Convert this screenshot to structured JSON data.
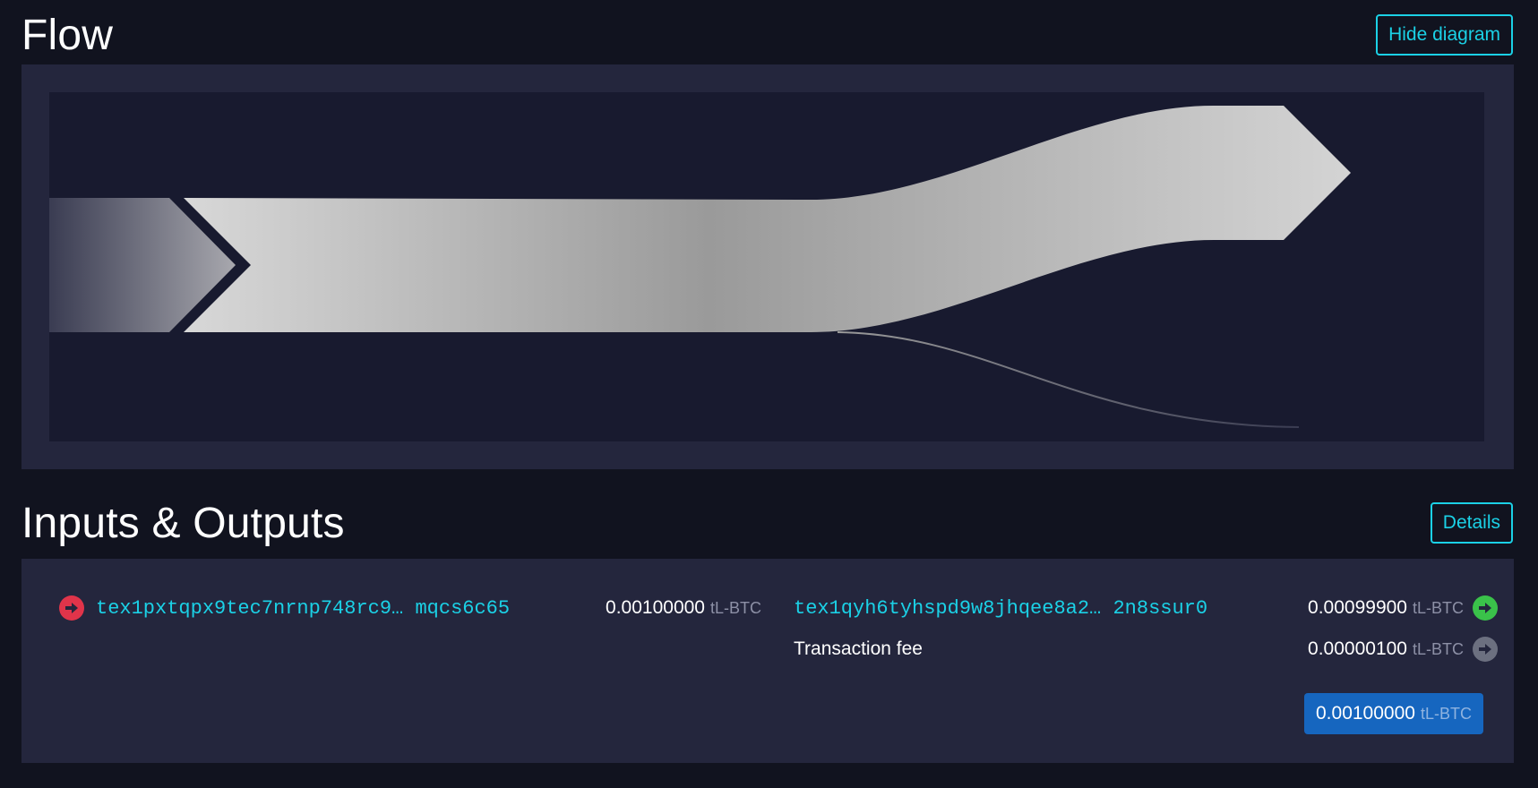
{
  "flow": {
    "title": "Flow",
    "hide_button": "Hide diagram",
    "diagram": {
      "input_value": 0.001,
      "output_value": 0.000999,
      "fee_value": 1e-06,
      "colors": {
        "flow_light": "#d6d6d6",
        "flow_mid": "#9a9a9a",
        "background": "#181a2f"
      }
    }
  },
  "io": {
    "title": "Inputs & Outputs",
    "details_button": "Details",
    "inputs": [
      {
        "address": "tex1pxtqpx9tec7nrnp748rc9… mqcs6c65",
        "amount": "0.00100000",
        "unit": "tL-BTC",
        "icon": "arrow-right-red-icon",
        "color": "#e0344a"
      }
    ],
    "outputs": [
      {
        "address": "tex1qyh6tyhspd9w8jhqee8a2… 2n8ssur0",
        "amount": "0.00099900",
        "unit": "tL-BTC",
        "icon": "arrow-right-green-icon",
        "color": "#3ac24a"
      },
      {
        "label": "Transaction fee",
        "amount": "0.00000100",
        "unit": "tL-BTC",
        "icon": "arrow-right-gray-icon",
        "color": "#6c7080"
      }
    ],
    "total": {
      "amount": "0.00100000",
      "unit": "tL-BTC"
    }
  }
}
